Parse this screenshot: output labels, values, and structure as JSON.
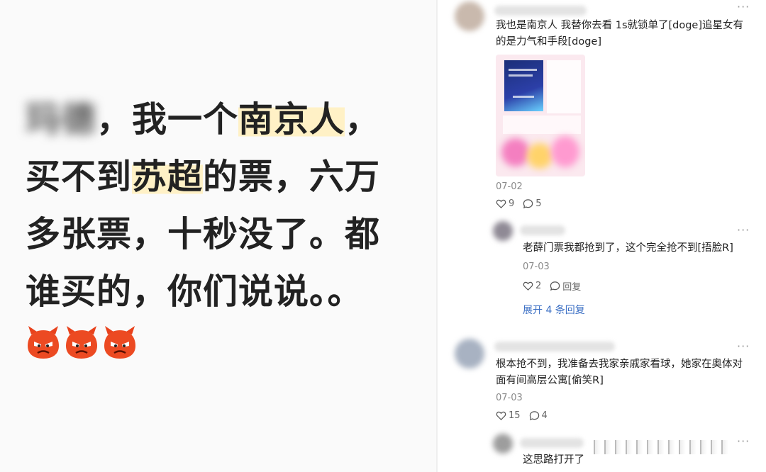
{
  "post": {
    "blurred_name": "玛德",
    "line1_a": "，我一个",
    "line1_hl": "南京人",
    "line1_b": "，",
    "line2_a": "买不到",
    "line2_hl": "苏超",
    "line2_b": "的票，六万",
    "line3": "多张票，十秒没了。都",
    "line4": "谁买的，你们说说。。",
    "emoji_count": 3,
    "emoji_icon": "angry-devil-emoji"
  },
  "comments": [
    {
      "text": "我也是南京人 我替你去看 1s就锁单了[doge]追星女有的是力气和手段[doge]",
      "date": "07-02",
      "likes": "9",
      "replies": "5",
      "more": "···"
    },
    {
      "text": "老薛门票我都抢到了，这个完全抢不到[捂脸R]",
      "date": "07-03",
      "likes": "2",
      "reply_label": "回复",
      "expand_label": "展开 4 条回复",
      "more": "···"
    },
    {
      "text": "根本抢不到，我准备去我家亲戚家看球，她家在奥体对面有间高层公寓[偷笑R]",
      "date": "07-03",
      "likes": "15",
      "replies": "4",
      "more": "···"
    },
    {
      "text": "这思路打开了",
      "more": "···"
    }
  ],
  "colors": {
    "highlight": "#fff1c6",
    "link": "#3b6fc4",
    "emoji_red": "#e8421c"
  }
}
